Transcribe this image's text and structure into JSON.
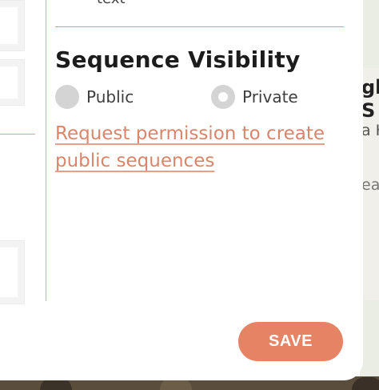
{
  "background": {
    "peek_lines": [
      "gl",
      "S",
      "a K",
      "ea"
    ]
  },
  "form": {
    "field_label": "text",
    "visibility": {
      "title": "Sequence Visibility",
      "options": [
        {
          "label": "Public",
          "selected": false
        },
        {
          "label": "Private",
          "selected": true
        }
      ],
      "request_link": "Request permission to create public sequences"
    },
    "save_label": "SAVE"
  },
  "colors": {
    "accent": "#e58364",
    "link": "#da856a",
    "divider": "#e39b80",
    "radio": "#d4d4d4"
  }
}
